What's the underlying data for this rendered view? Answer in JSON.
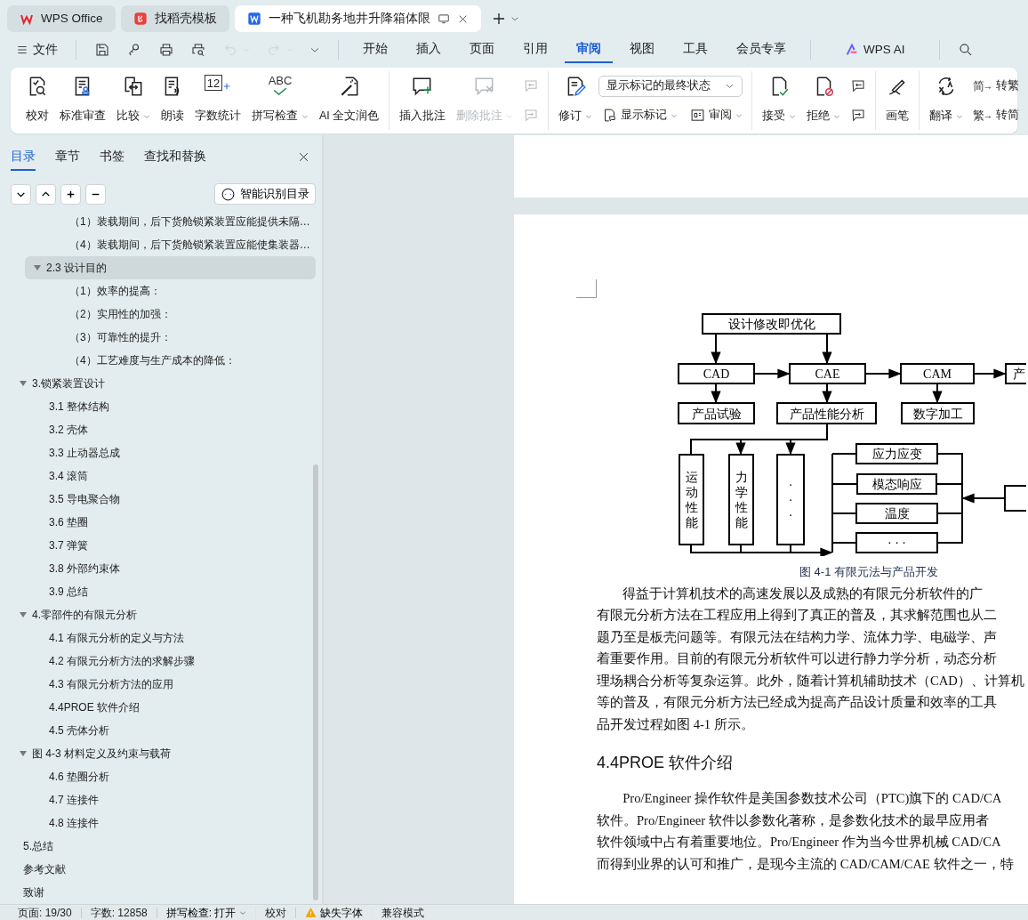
{
  "tabs": [
    {
      "label": "WPS Office",
      "selected": false
    },
    {
      "label": "找稻壳模板",
      "selected": false
    },
    {
      "label": "一种飞机勘务地井升降箱体限",
      "selected": true
    }
  ],
  "quick_access": [
    {
      "disabled": false
    },
    {
      "disabled": false
    },
    {
      "disabled": false
    },
    {
      "disabled": false
    },
    {
      "disabled": true
    },
    {
      "disabled": true
    }
  ],
  "menu": {
    "file": "文件",
    "tabs": [
      {
        "label": "开始",
        "selected": false
      },
      {
        "label": "插入",
        "selected": false
      },
      {
        "label": "页面",
        "selected": false
      },
      {
        "label": "引用",
        "selected": false
      },
      {
        "label": "审阅",
        "selected": true
      },
      {
        "label": "视图",
        "selected": false
      },
      {
        "label": "工具",
        "selected": false
      },
      {
        "label": "会员专享",
        "selected": false
      }
    ],
    "ai": "WPS AI"
  },
  "ribbon": {
    "groups": [
      {
        "items": [
          {
            "kind": "large",
            "label": "校对",
            "caret": false,
            "disabled": false
          },
          {
            "kind": "large",
            "label": "标准审查",
            "caret": false,
            "disabled": false
          },
          {
            "kind": "large",
            "label": "比较",
            "caret": true,
            "disabled": false
          },
          {
            "kind": "large",
            "label": "朗读",
            "caret": false,
            "disabled": false
          },
          {
            "kind": "large",
            "label": "字数统计",
            "glyph": "12",
            "caret": false,
            "disabled": false
          },
          {
            "kind": "large",
            "label": "拼写检查",
            "glyph": "ABC",
            "caret": true,
            "disabled": false
          },
          {
            "kind": "large",
            "label": "AI 全文润色",
            "caret": false,
            "disabled": false
          }
        ]
      },
      {
        "items": [
          {
            "kind": "large",
            "label": "插入批注",
            "caret": false,
            "disabled": false
          },
          {
            "kind": "large",
            "label": "删除批注",
            "caret": true,
            "disabled": true
          },
          {
            "kind": "stack",
            "items": [
              {
                "kind": "icon",
                "disabled": true
              },
              {
                "kind": "icon",
                "disabled": true
              }
            ]
          }
        ]
      },
      {
        "items": [
          {
            "kind": "large",
            "label": "修订",
            "caret": true,
            "disabled": false
          },
          {
            "kind": "stack",
            "items": [
              {
                "kind": "select",
                "value": "显示标记的最终状态"
              },
              {
                "kind": "row",
                "items": [
                  {
                    "kind": "small",
                    "label": "显示标记",
                    "caret": true,
                    "disabled": false
                  },
                  {
                    "kind": "small",
                    "label": "审阅",
                    "caret": true,
                    "disabled": false
                  }
                ]
              }
            ]
          }
        ]
      },
      {
        "items": [
          {
            "kind": "large",
            "label": "接受",
            "caret": true,
            "disabled": false
          },
          {
            "kind": "large",
            "label": "拒绝",
            "caret": true,
            "disabled": false
          },
          {
            "kind": "stack",
            "items": [
              {
                "kind": "icon",
                "disabled": false
              },
              {
                "kind": "icon",
                "disabled": false
              }
            ]
          }
        ]
      },
      {
        "items": [
          {
            "kind": "large",
            "label": "画笔",
            "caret": false,
            "disabled": false
          }
        ]
      },
      {
        "items": [
          {
            "kind": "large",
            "label": "翻译",
            "caret": true,
            "disabled": false
          },
          {
            "kind": "stack",
            "items": [
              {
                "kind": "small",
                "label": "转繁",
                "glyph": "简",
                "caret": false,
                "disabled": false
              },
              {
                "kind": "small",
                "label": "转简",
                "glyph": "繁",
                "caret": false,
                "disabled": false
              }
            ]
          }
        ]
      }
    ]
  },
  "nav_panel": {
    "tabs": [
      {
        "label": "目录",
        "selected": true
      },
      {
        "label": "章节",
        "selected": false
      },
      {
        "label": "书签",
        "selected": false
      },
      {
        "label": "查找和替换",
        "selected": false
      }
    ],
    "smart_button": "智能识别目录",
    "toc": [
      {
        "children": [
          {
            "children": [
              {
                "label": "（1）装载期间，后下货舱锁紧装置应能提供未隔…",
                "selected": false
              },
              {
                "label": "（4）装载期间，后下货舱锁紧装置应能使集装器…",
                "selected": false
              }
            ]
          },
          {
            "label": "2.3 设计目的",
            "selected": true,
            "expanded": true,
            "children": [
              {
                "label": "（1）效率的提高：",
                "selected": false
              },
              {
                "label": "（2）实用性的加强：",
                "selected": false
              },
              {
                "label": "（3）可靠性的提升：",
                "selected": false
              },
              {
                "label": "（4）工艺难度与生产成本的降低：",
                "selected": false
              }
            ]
          }
        ]
      },
      {
        "label": "3.锁紧装置设计",
        "selected": false,
        "expanded": true,
        "children": [
          {
            "label": "3.1 整体结构",
            "selected": false
          },
          {
            "label": "3.2 壳体",
            "selected": false
          },
          {
            "label": "3.3 止动器总成",
            "selected": false
          },
          {
            "label": "3.4 滚筒",
            "selected": false
          },
          {
            "label": "3.5 导电聚合物",
            "selected": false
          },
          {
            "label": "3.6 垫圈",
            "selected": false
          },
          {
            "label": "3.7 弹簧",
            "selected": false
          },
          {
            "label": "3.8 外部约束体",
            "selected": false
          },
          {
            "label": "3.9 总结",
            "selected": false
          }
        ]
      },
      {
        "label": "4.零部件的有限元分析",
        "selected": false,
        "expanded": true,
        "children": [
          {
            "label": "4.1 有限元分析的定义与方法",
            "selected": false
          },
          {
            "label": "4.2 有限元分析方法的求解步骤",
            "selected": false
          },
          {
            "label": "4.3 有限元分析方法的应用",
            "selected": false
          },
          {
            "label": "4.4PROE 软件介绍",
            "selected": false
          },
          {
            "label": "4.5 壳体分析",
            "selected": false
          }
        ]
      },
      {
        "label": "图 4-3 材料定义及约束与载荷",
        "selected": false,
        "expanded": true,
        "children": [
          {
            "label": "4.6 垫圈分析",
            "selected": false
          },
          {
            "label": "4.7 连接件",
            "selected": false
          },
          {
            "label": "4.8 连接件",
            "selected": false
          }
        ]
      },
      {
        "label": "5.总结",
        "selected": false
      },
      {
        "label": "参考文献",
        "selected": false
      },
      {
        "label": "致谢",
        "selected": false
      }
    ]
  },
  "document": {
    "figure": {
      "nodes": [
        {
          "kind": "box",
          "label": "设计修改即优化"
        },
        {
          "kind": "box",
          "label": "CAD"
        },
        {
          "kind": "box",
          "label": "CAE"
        },
        {
          "kind": "box",
          "label": "CAM"
        },
        {
          "kind": "box",
          "label": "产"
        },
        {
          "kind": "box",
          "label": "产品试验"
        },
        {
          "kind": "box",
          "label": "产品性能分析"
        },
        {
          "kind": "box",
          "label": "数字加工"
        },
        {
          "kind": "vertical",
          "label": "运动性能"
        },
        {
          "kind": "vertical",
          "label": "力学性能"
        },
        {
          "kind": "vertical",
          "label": "···"
        },
        {
          "kind": "box",
          "label": "应力应变"
        },
        {
          "kind": "box",
          "label": "模态响应"
        },
        {
          "kind": "box",
          "label": "温度"
        },
        {
          "kind": "box",
          "label": "· · ·"
        },
        {
          "kind": "box"
        }
      ],
      "caption": "图 4-1  有限元法与产品开发"
    },
    "blocks": [
      {
        "kind": "paragraph",
        "lines": [
          "得益于计算机技术的高速发展以及成熟的有限元分析软件的广",
          "有限元分析方法在工程应用上得到了真正的普及，其求解范围也从二",
          "题乃至是板壳问题等。有限元法在结构力学、流体力学、电磁学、声",
          "着重要作用。目前的有限元分析软件可以进行静力学分析，动态分析",
          "理场耦合分析等复杂运算。此外，随着计算机辅助技术（CAD）、计算机",
          "等的普及，有限元分析方法已经成为提高产品设计质量和效率的工具",
          "品开发过程如图 4-1 所示。"
        ]
      },
      {
        "kind": "heading",
        "text": "4.4PROE 软件介绍"
      },
      {
        "kind": "paragraph",
        "lines": [
          "Pro/Engineer 操作软件是美国参数技术公司（PTC)旗下的 CAD/CA",
          "软件。Pro/Engineer 软件以参数化著称，是参数化技术的最早应用者",
          "软件领域中占有着重要地位。Pro/Engineer 作为当今世界机械 CAD/CA",
          "而得到业界的认可和推广，是现今主流的 CAD/CAM/CAE 软件之一，特"
        ]
      }
    ]
  },
  "status_bar": [
    {
      "kind": "plain",
      "text": "页面: 19/30"
    },
    {
      "kind": "plain",
      "text": "字数: 12858"
    },
    {
      "kind": "dropdown",
      "text": "拼写检查: 打开"
    },
    {
      "kind": "plain",
      "text": "校对"
    },
    {
      "kind": "warning",
      "text": "缺失字体"
    },
    {
      "kind": "plain",
      "text": "兼容模式"
    }
  ]
}
